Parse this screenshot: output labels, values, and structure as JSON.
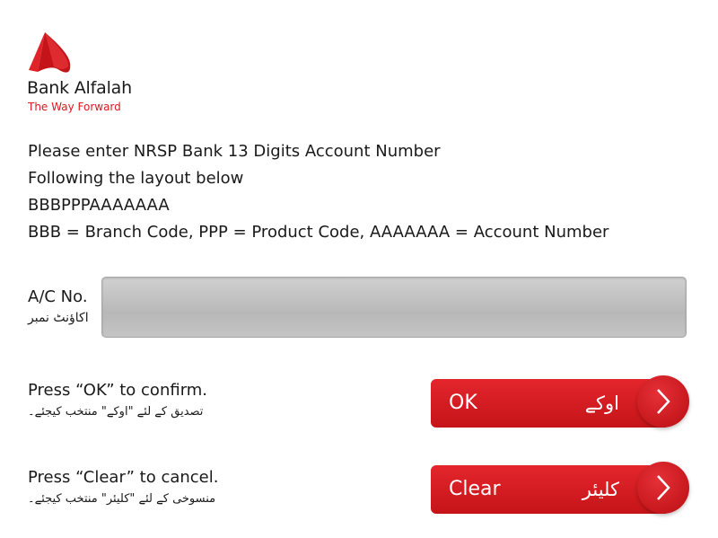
{
  "brand": {
    "name": "Bank Alfalah",
    "tagline": "The Way Forward",
    "accent_color": "#d71920"
  },
  "instructions": [
    "Please enter NRSP Bank 13 Digits Account Number",
    "Following the layout below",
    "BBBPPPAAAAAAA",
    "BBB = Branch Code, PPP = Product Code, AAAAAAA = Account Number"
  ],
  "account_field": {
    "label": "A/C No.",
    "label_urdu": "اکاؤنٹ نمبر",
    "value": ""
  },
  "confirm": {
    "prompt": "Press “OK” to confirm.",
    "prompt_urdu": "تصدیق کے لئے \"اوکے\" منتخب کیجئے۔",
    "button_label": "OK",
    "button_label_urdu": "اوکے"
  },
  "cancel": {
    "prompt": "Press “Clear” to cancel.",
    "prompt_urdu": "منسوخی کے لئے \"کلیئر\" منتخب کیجئے۔",
    "button_label": "Clear",
    "button_label_urdu": "کلیئر"
  },
  "icons": {
    "logo": "bank-alfalah-logo-icon",
    "button_arrow": "chevron-right-icon"
  }
}
